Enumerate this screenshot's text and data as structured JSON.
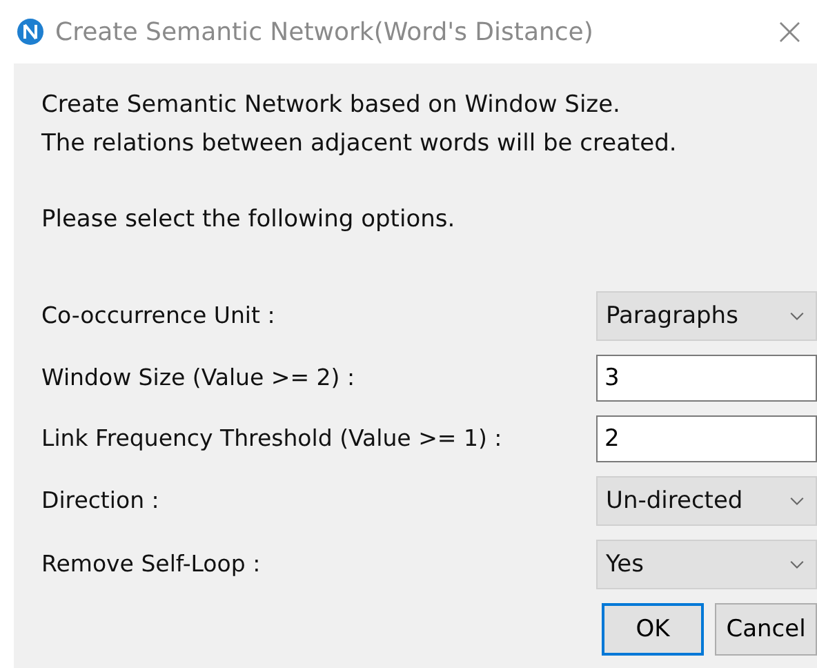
{
  "window": {
    "title": "Create Semantic Network(Word's Distance)",
    "close": "×"
  },
  "intro": [
    "Create Semantic Network based on Window Size.",
    "The relations between adjacent words will be created."
  ],
  "prompt": "Please select the following options.",
  "options": [
    {
      "label": "Co-occurrence Unit :",
      "kind": "select",
      "value": "Paragraphs"
    },
    {
      "label": "Window Size (Value >= 2) :",
      "kind": "text",
      "value": "3"
    },
    {
      "label": "Link Frequency Threshold (Value >= 1) :",
      "kind": "text",
      "value": "2"
    },
    {
      "label": "Direction :",
      "kind": "select",
      "value": "Un-directed"
    },
    {
      "label": "Remove Self-Loop :",
      "kind": "select",
      "value": "Yes"
    }
  ],
  "buttons": [
    {
      "label": "OK",
      "default": true
    },
    {
      "label": "Cancel",
      "default": false
    }
  ]
}
